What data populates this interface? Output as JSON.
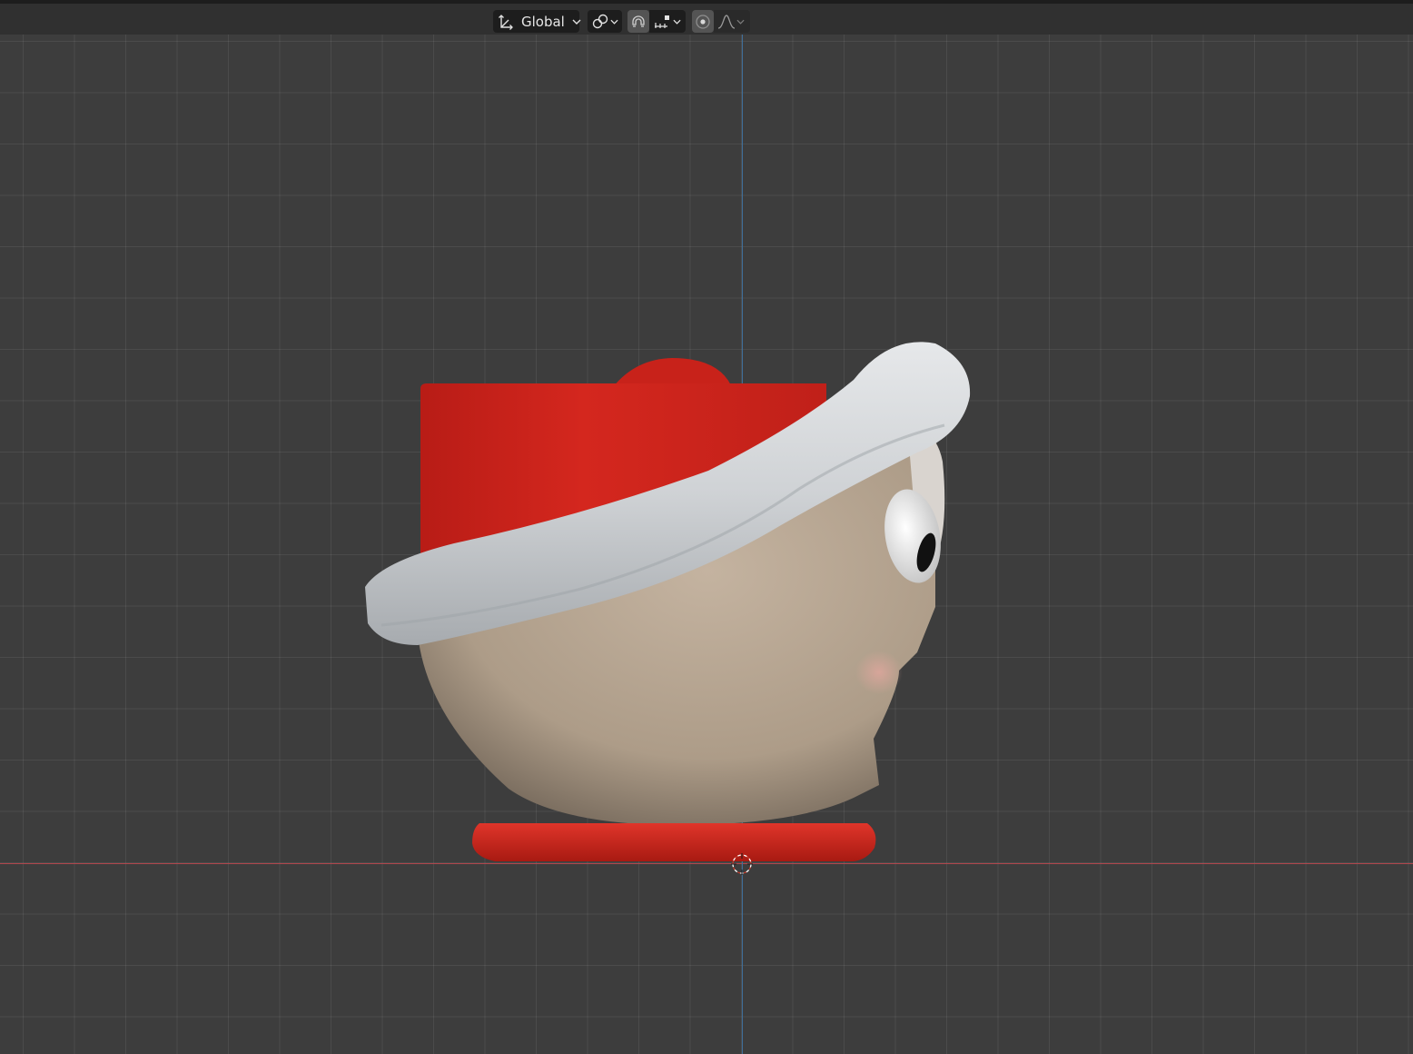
{
  "header": {
    "transform_orientation": {
      "label": "Global",
      "icon": "transform-orientation-icon",
      "dropdown_icon": "chevron-down-icon"
    },
    "pivot_point": {
      "icon": "pivot-link-icon",
      "dropdown_icon": "chevron-down-icon"
    },
    "snapping": {
      "toggle_icon": "magnet-icon",
      "target_icon": "snap-increment-icon",
      "dropdown_icon": "chevron-down-icon",
      "active": true
    },
    "proportional_editing": {
      "toggle_icon": "proportional-edit-icon",
      "falloff_icon": "falloff-curve-icon",
      "dropdown_icon": "chevron-down-icon"
    }
  },
  "viewport": {
    "grid": true,
    "x_axis_color": "#b0464c",
    "z_axis_color": "#3f6f9a",
    "background": "#3d3d3d",
    "object": "santa-hat-character-mug",
    "colors": {
      "hat": "#c8201a",
      "fur_trim": "#d8dbde",
      "face": "#b9a894",
      "base": "#d42a1e",
      "eye": "#efefef",
      "pupil": "#111111"
    },
    "cursor_icon": "3d-cursor-icon"
  }
}
